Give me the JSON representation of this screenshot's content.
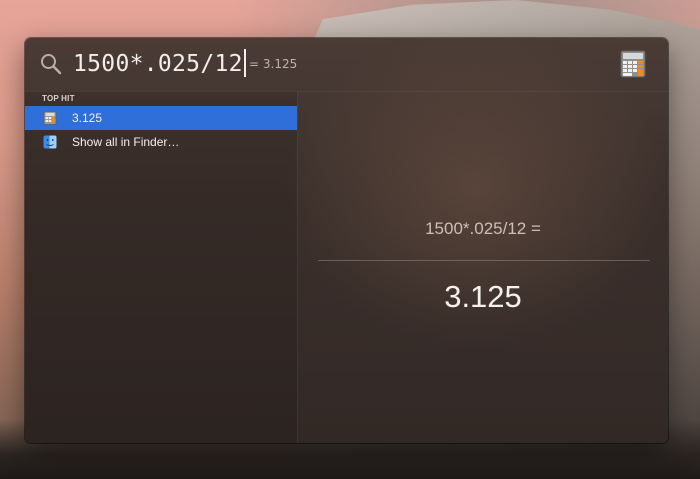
{
  "search": {
    "query": "1500*.025/12",
    "inline_result": "= 3.125"
  },
  "results": {
    "section_header": "TOP HIT",
    "items": [
      {
        "label": "3.125",
        "icon": "calculator-icon",
        "selected": true
      },
      {
        "label": "Show all in Finder…",
        "icon": "finder-icon",
        "selected": false
      }
    ]
  },
  "preview": {
    "expression": "1500*.025/12 =",
    "result": "3.125"
  },
  "colors": {
    "selection": "#2f6fd9",
    "panel": "#3b2f2b"
  }
}
